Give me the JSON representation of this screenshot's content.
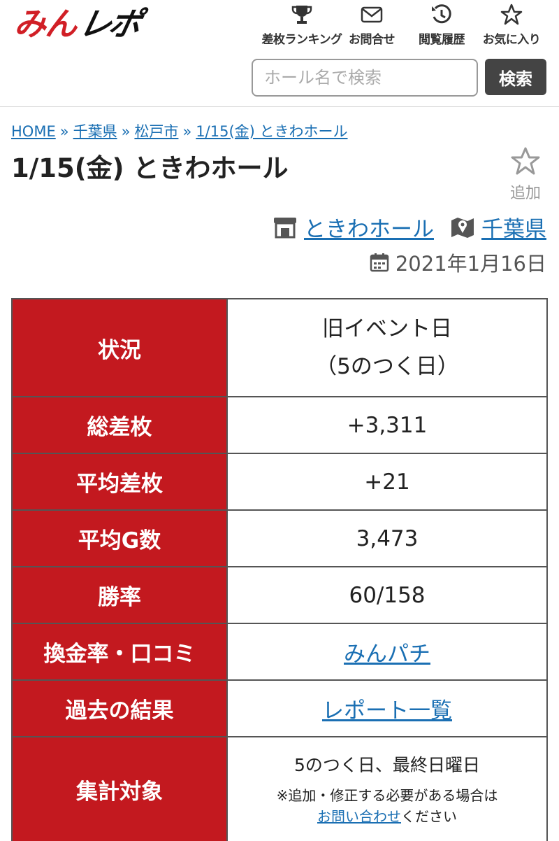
{
  "header": {
    "logo_part1": "みん",
    "logo_part2": "レポ",
    "nav": [
      {
        "icon": "trophy-icon",
        "label": "差枚ランキング"
      },
      {
        "icon": "mail-icon",
        "label": "お問合せ"
      },
      {
        "icon": "history-icon",
        "label": "閲覧履歴"
      },
      {
        "icon": "star-icon",
        "label": "お気に入り"
      }
    ],
    "search": {
      "placeholder": "ホール名で検索",
      "value": "",
      "button_label": "検索"
    }
  },
  "breadcrumb": {
    "items": [
      "HOME",
      "千葉県",
      "松戸市",
      "1/15(金) ときわホール"
    ],
    "separator": "»"
  },
  "page": {
    "title": "1/15(金) ときわホール",
    "fav_label": "追加",
    "hall_link": "ときわホール",
    "pref_link": "千葉県",
    "date": "2021年1月16日"
  },
  "table": {
    "status": {
      "label": "状況",
      "line1": "旧イベント日",
      "line2": "（5のつく日）"
    },
    "total_diff": {
      "label": "総差枚",
      "value": "+3,311"
    },
    "avg_diff": {
      "label": "平均差枚",
      "value": "+21"
    },
    "avg_games": {
      "label": "平均G数",
      "value": "3,473"
    },
    "win_rate": {
      "label": "勝率",
      "value": "60/158"
    },
    "exchange": {
      "label": "換金率・口コミ",
      "link": "みんパチ"
    },
    "past": {
      "label": "過去の結果",
      "link": "レポート一覧"
    },
    "target": {
      "label": "集計対象",
      "value": "5のつく日、最終日曜日",
      "note1": "※追加・修正する必要がある場合は",
      "note_link": "お問い合わせ",
      "note2": "ください"
    }
  },
  "colors": {
    "brand_red": "#c3191f",
    "link_blue": "#1a6fb3",
    "button_dark": "#444444"
  }
}
